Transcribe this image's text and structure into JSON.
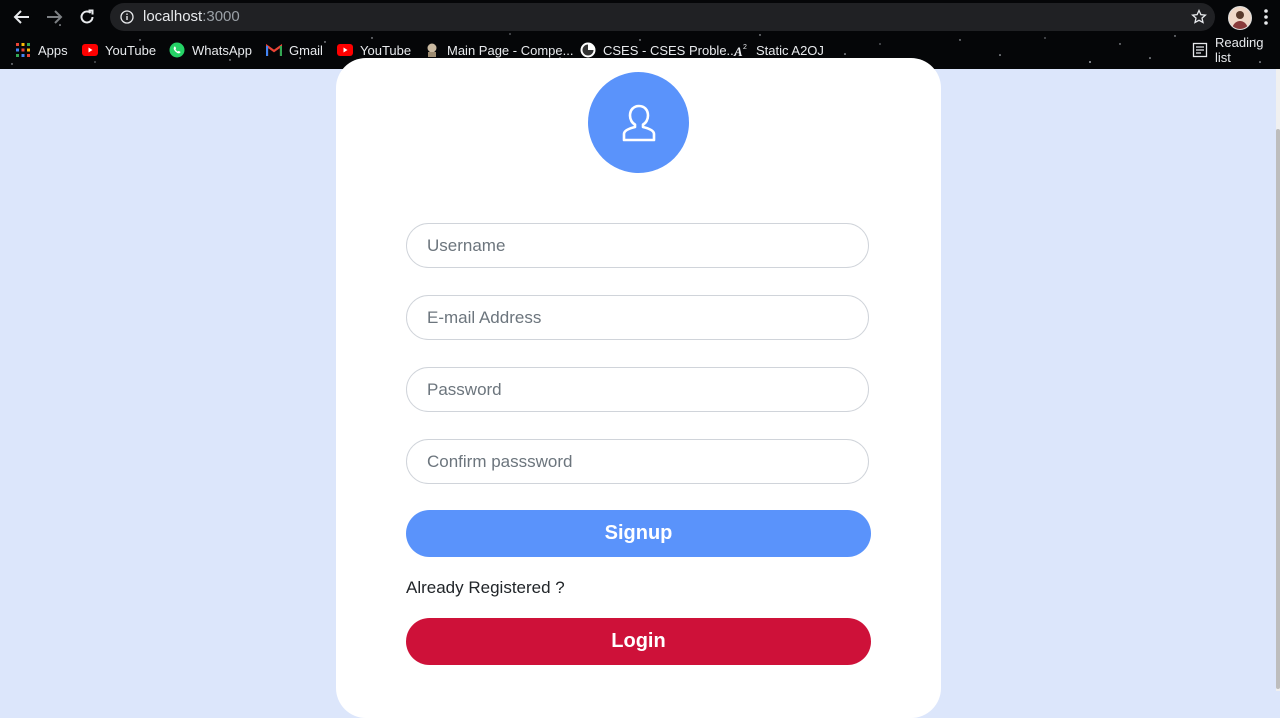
{
  "browser": {
    "url_host": "localhost",
    "url_port": ":3000",
    "bookmarks": [
      {
        "label": "Apps",
        "icon": "apps-grid-icon"
      },
      {
        "label": "YouTube",
        "icon": "youtube-icon"
      },
      {
        "label": "WhatsApp",
        "icon": "whatsapp-icon"
      },
      {
        "label": "Gmail",
        "icon": "gmail-icon"
      },
      {
        "label": "YouTube",
        "icon": "youtube-icon"
      },
      {
        "label": "Main Page - Compe...",
        "icon": "site-favicon-icon"
      },
      {
        "label": "CSES - CSES Proble...",
        "icon": "cses-icon"
      },
      {
        "label": "Static A2OJ",
        "icon": "a2oj-icon"
      }
    ],
    "reading_list": "Reading list"
  },
  "form": {
    "username_placeholder": "Username",
    "email_placeholder": "E-mail Address",
    "password_placeholder": "Password",
    "confirm_placeholder": "Confirm passsword",
    "signup_label": "Signup",
    "already_text": "Already Registered ?",
    "login_label": "Login"
  },
  "colors": {
    "page_bg": "#dce6fb",
    "primary_blue": "#5a93fb",
    "login_red": "#ce1139"
  }
}
